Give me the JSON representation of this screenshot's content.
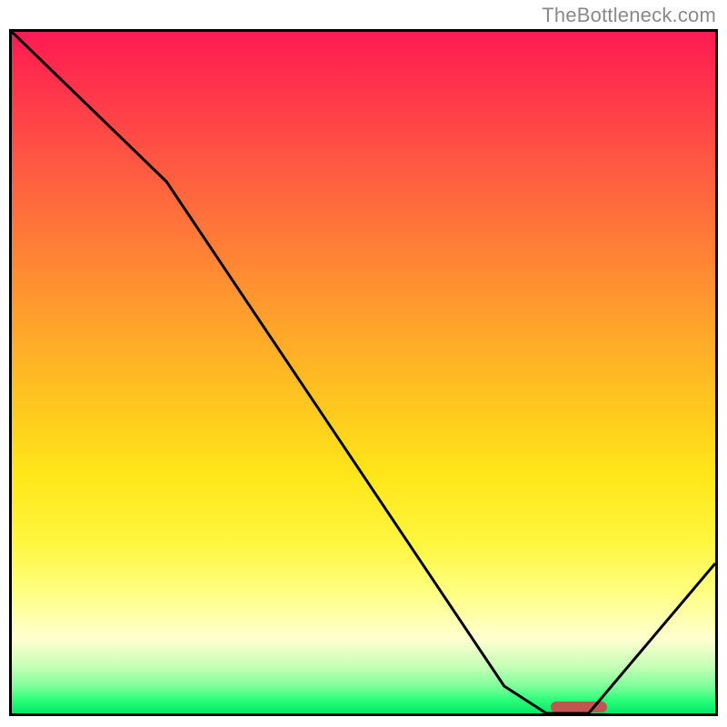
{
  "watermark": "TheBottleneck.com",
  "colors": {
    "gradient_top": "#ff1a52",
    "gradient_mid_upper": "#ff9a2e",
    "gradient_mid": "#ffe619",
    "gradient_lower": "#ffffd0",
    "gradient_bottom": "#00e867",
    "curve": "#000000",
    "marker": "#c1554f",
    "border": "#000000"
  },
  "chart_data": {
    "type": "line",
    "title": "",
    "xlabel": "",
    "ylabel": "",
    "xlim": [
      0,
      100
    ],
    "ylim": [
      0,
      100
    ],
    "grid": false,
    "series": [
      {
        "name": "curve",
        "x": [
          0,
          22,
          70,
          76,
          82,
          100
        ],
        "y": [
          100,
          78,
          4,
          0,
          0,
          22
        ]
      }
    ],
    "marker": {
      "x_start": 76,
      "x_end": 84,
      "y": 0,
      "shape": "rounded-bar",
      "color": "#c1554f"
    },
    "background": "vertical-gradient red→orange→yellow→green",
    "notes": "No axis ticks or numeric labels are shown; x/y are normalized 0–100. Curve values estimated from pixel positions."
  }
}
